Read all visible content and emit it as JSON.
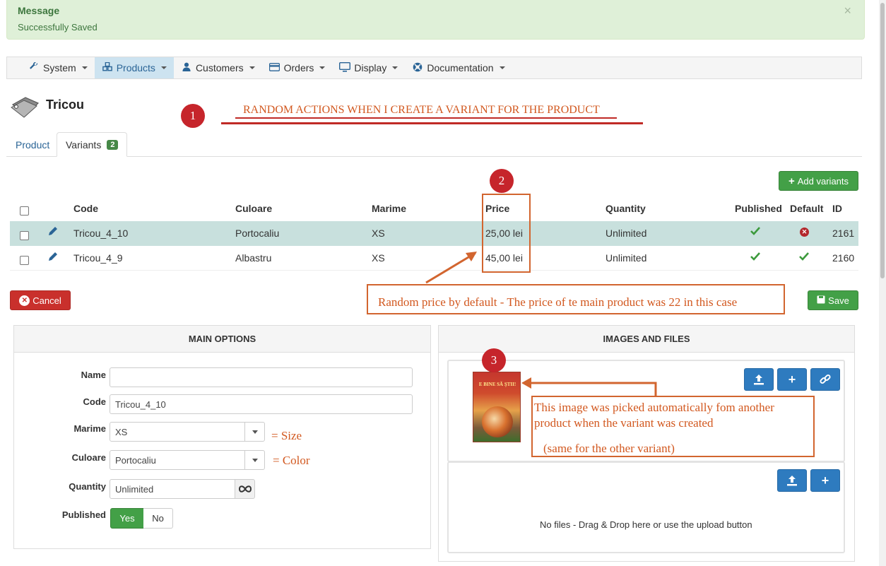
{
  "alert": {
    "title": "Message",
    "text": "Successfully Saved",
    "close": "×"
  },
  "navbar": {
    "items": [
      {
        "label": "System",
        "icon": "wrench-icon"
      },
      {
        "label": "Products",
        "icon": "cubes-icon"
      },
      {
        "label": "Customers",
        "icon": "user-icon"
      },
      {
        "label": "Orders",
        "icon": "card-icon"
      },
      {
        "label": "Display",
        "icon": "monitor-icon"
      },
      {
        "label": "Documentation",
        "icon": "lifebuoy-icon"
      }
    ]
  },
  "page": {
    "title": "Tricou"
  },
  "tabs": {
    "product": "Product",
    "variants": "Variants",
    "variants_count": "2"
  },
  "toolbar": {
    "add_variants": "Add variants",
    "cancel": "Cancel",
    "save": "Save"
  },
  "table": {
    "headers": {
      "code": "Code",
      "culoare": "Culoare",
      "marime": "Marime",
      "price": "Price",
      "quantity": "Quantity",
      "published": "Published",
      "default": "Default",
      "id": "ID"
    },
    "rows": [
      {
        "code": "Tricou_4_10",
        "culoare": "Portocaliu",
        "marime": "XS",
        "price": "25,00 lei",
        "quantity": "Unlimited",
        "published": true,
        "default": false,
        "id": "2161"
      },
      {
        "code": "Tricou_4_9",
        "culoare": "Albastru",
        "marime": "XS",
        "price": "45,00 lei",
        "quantity": "Unlimited",
        "published": true,
        "default": true,
        "id": "2160"
      }
    ]
  },
  "main_options": {
    "heading": "MAIN OPTIONS",
    "name_label": "Name",
    "name_value": "",
    "code_label": "Code",
    "code_value": "Tricou_4_10",
    "marime_label": "Marime",
    "marime_value": "XS",
    "culoare_label": "Culoare",
    "culoare_value": "Portocaliu",
    "quantity_label": "Quantity",
    "quantity_value": "Unlimited",
    "published_label": "Published",
    "yes": "Yes",
    "no": "No"
  },
  "images": {
    "heading": "IMAGES AND FILES",
    "book_title": "E BINE SĂ ŞTII!",
    "no_files": "No files - Drag & Drop here or use the upload button"
  },
  "annotations": {
    "n1": "1",
    "n2": "2",
    "n3": "3",
    "title": "RANDOM ACTIONS WHEN I CREATE A VARIANT FOR THE PRODUCT",
    "price_note": "Random price by default - The price of te main product was 22 in this case",
    "image_note_1": "This image was picked automatically fom another",
    "image_note_2": "product when the variant was created",
    "image_note_3": "(same for the other variant)",
    "size_note": "= Size",
    "color_note": "= Color"
  },
  "colors": {
    "accent": "#2a6496",
    "success": "#43a047",
    "danger": "#c9302c",
    "annotation": "#d2581f",
    "badge": "#c6252b"
  }
}
